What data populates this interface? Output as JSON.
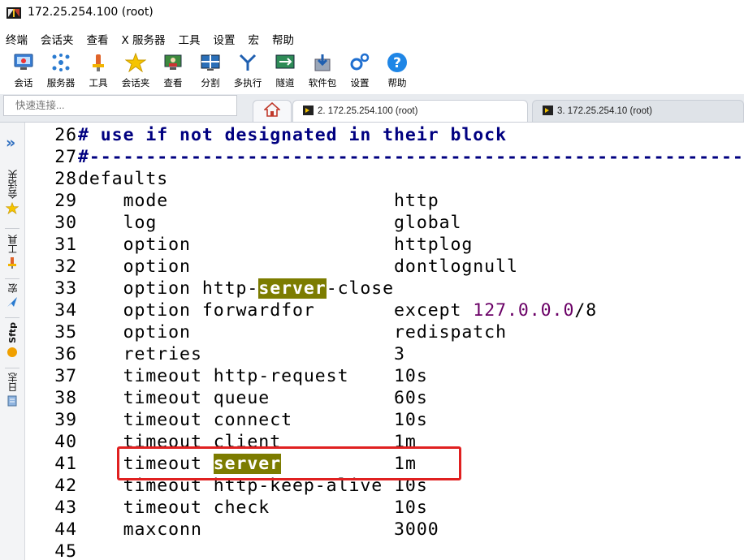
{
  "window": {
    "title": "172.25.254.100 (root)"
  },
  "menu": [
    "终端",
    "会话夹",
    "查看",
    "X 服务器",
    "工具",
    "设置",
    "宏",
    "帮助"
  ],
  "toolbar": [
    {
      "label": "会话",
      "icon": "session-icon"
    },
    {
      "label": "服务器",
      "icon": "servers-icon"
    },
    {
      "label": "工具",
      "icon": "tools-icon"
    },
    {
      "label": "会话夹",
      "icon": "star-icon"
    },
    {
      "label": "查看",
      "icon": "view-icon"
    },
    {
      "label": "分割",
      "icon": "split-icon"
    },
    {
      "label": "多执行",
      "icon": "multiexec-icon"
    },
    {
      "label": "隧道",
      "icon": "tunnel-icon"
    },
    {
      "label": "软件包",
      "icon": "package-icon"
    },
    {
      "label": "设置",
      "icon": "settings-icon"
    },
    {
      "label": "帮助",
      "icon": "help-icon"
    }
  ],
  "quick_connect": {
    "placeholder": "快速连接..."
  },
  "tabs": [
    {
      "label": "2. 172.25.254.100 (root)",
      "active": true
    },
    {
      "label": "3. 172.25.254.10 (root)",
      "active": false
    }
  ],
  "side_panel": [
    "会话夹",
    "工具",
    "宏",
    "Sftp",
    "日志"
  ],
  "terminal": {
    "lines": [
      {
        "n": "26",
        "parts": [
          {
            "t": "# use if not designated in their block",
            "s": "comment"
          }
        ]
      },
      {
        "n": "27",
        "parts": [
          {
            "t": "#-----------------------------------------------------------",
            "s": "comment"
          }
        ]
      },
      {
        "n": "28",
        "parts": [
          {
            "t": "defaults"
          }
        ]
      },
      {
        "n": "29",
        "parts": [
          {
            "t": "    mode                    http"
          }
        ]
      },
      {
        "n": "30",
        "parts": [
          {
            "t": "    log                     global"
          }
        ]
      },
      {
        "n": "31",
        "parts": [
          {
            "t": "    option                  httplog"
          }
        ]
      },
      {
        "n": "32",
        "parts": [
          {
            "t": "    option                  dontlognull"
          }
        ]
      },
      {
        "n": "33",
        "parts": [
          {
            "t": "    option http-"
          },
          {
            "t": "server",
            "s": "hl"
          },
          {
            "t": "-close"
          }
        ]
      },
      {
        "n": "34",
        "parts": [
          {
            "t": "    option forwardfor       except "
          },
          {
            "t": "127.0.0.0",
            "s": "num"
          },
          {
            "t": "/8"
          }
        ]
      },
      {
        "n": "35",
        "parts": [
          {
            "t": "    option                  redispatch"
          }
        ]
      },
      {
        "n": "36",
        "parts": [
          {
            "t": "    retries                 3"
          }
        ]
      },
      {
        "n": "37",
        "parts": [
          {
            "t": "    timeout http-request    10s"
          }
        ]
      },
      {
        "n": "38",
        "parts": [
          {
            "t": "    timeout queue           60s"
          }
        ]
      },
      {
        "n": "39",
        "parts": [
          {
            "t": "    timeout connect         10s"
          }
        ]
      },
      {
        "n": "40",
        "parts": [
          {
            "t": "    timeout client          1m"
          }
        ]
      },
      {
        "n": "41",
        "parts": [
          {
            "t": "    timeout "
          },
          {
            "t": "server",
            "s": "hl"
          },
          {
            "t": "          1m"
          }
        ]
      },
      {
        "n": "42",
        "parts": [
          {
            "t": "    timeout http-keep-alive 10s"
          }
        ]
      },
      {
        "n": "43",
        "parts": [
          {
            "t": "    timeout check           10s"
          }
        ]
      },
      {
        "n": "44",
        "parts": [
          {
            "t": "    maxconn                 3000"
          }
        ]
      },
      {
        "n": "45",
        "parts": [
          {
            "t": ""
          }
        ]
      }
    ]
  }
}
